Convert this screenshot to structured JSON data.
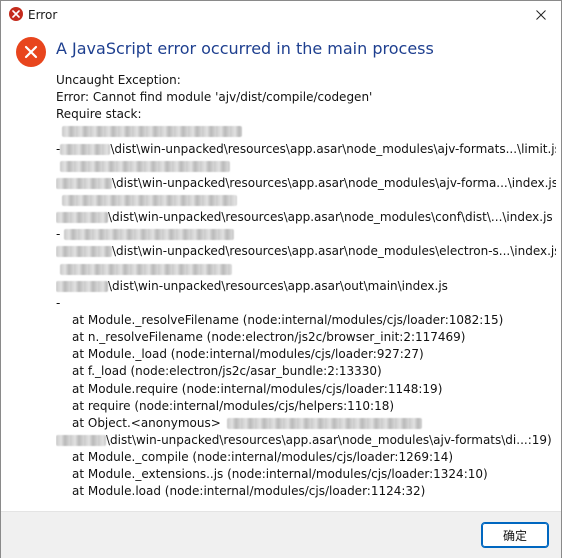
{
  "window": {
    "title": "Error"
  },
  "dialog": {
    "heading": "A JavaScript error occurred in the main process",
    "lines": [
      "Uncaught Exception:",
      "Error: Cannot find module 'ajv/dist/compile/codegen'",
      "Require stack:",
      "",
      "-",
      "\\dist\\win-unpacked\\resources\\app.asar\\node_modules\\ajv-formats...\\limit.js",
      "",
      "\\dist\\win-unpacked\\resources\\app.asar\\node_modules\\ajv-forma...\\index.js",
      "",
      "\\dist\\win-unpacked\\resources\\app.asar\\node_modules\\conf\\dist\\...\\index.js",
      "-",
      "\\dist\\win-unpacked\\resources\\app.asar\\node_modules\\electron-s...\\index.js",
      "",
      "\\dist\\win-unpacked\\resources\\app.asar\\out\\main\\index.js",
      "-",
      "at Module._resolveFilename (node:internal/modules/cjs/loader:1082:15)",
      "at n._resolveFilename (node:electron/js2c/browser_init:2:117469)",
      "at Module._load (node:internal/modules/cjs/loader:927:27)",
      "at f._load (node:electron/js2c/asar_bundle:2:13330)",
      "at Module.require (node:internal/modules/cjs/loader:1148:19)",
      "at require (node:internal/modules/cjs/helpers:110:18)",
      "at Object.<anonymous>",
      "\\dist\\win-unpacked\\resources\\app.asar\\node_modules\\ajv-formats\\di...:19)",
      "at Module._compile (node:internal/modules/cjs/loader:1269:14)",
      "at Module._extensions..js (node:internal/modules/cjs/loader:1324:10)",
      "at Module.load (node:internal/modules/cjs/loader:1124:32)"
    ]
  },
  "footer": {
    "ok_label": "确定"
  },
  "icons": {
    "title": "error-icon",
    "close": "close-icon",
    "big": "error-icon"
  },
  "colors": {
    "heading": "#1e3f8f",
    "error_icon": "#e8451d",
    "accent": "#0067c0"
  }
}
